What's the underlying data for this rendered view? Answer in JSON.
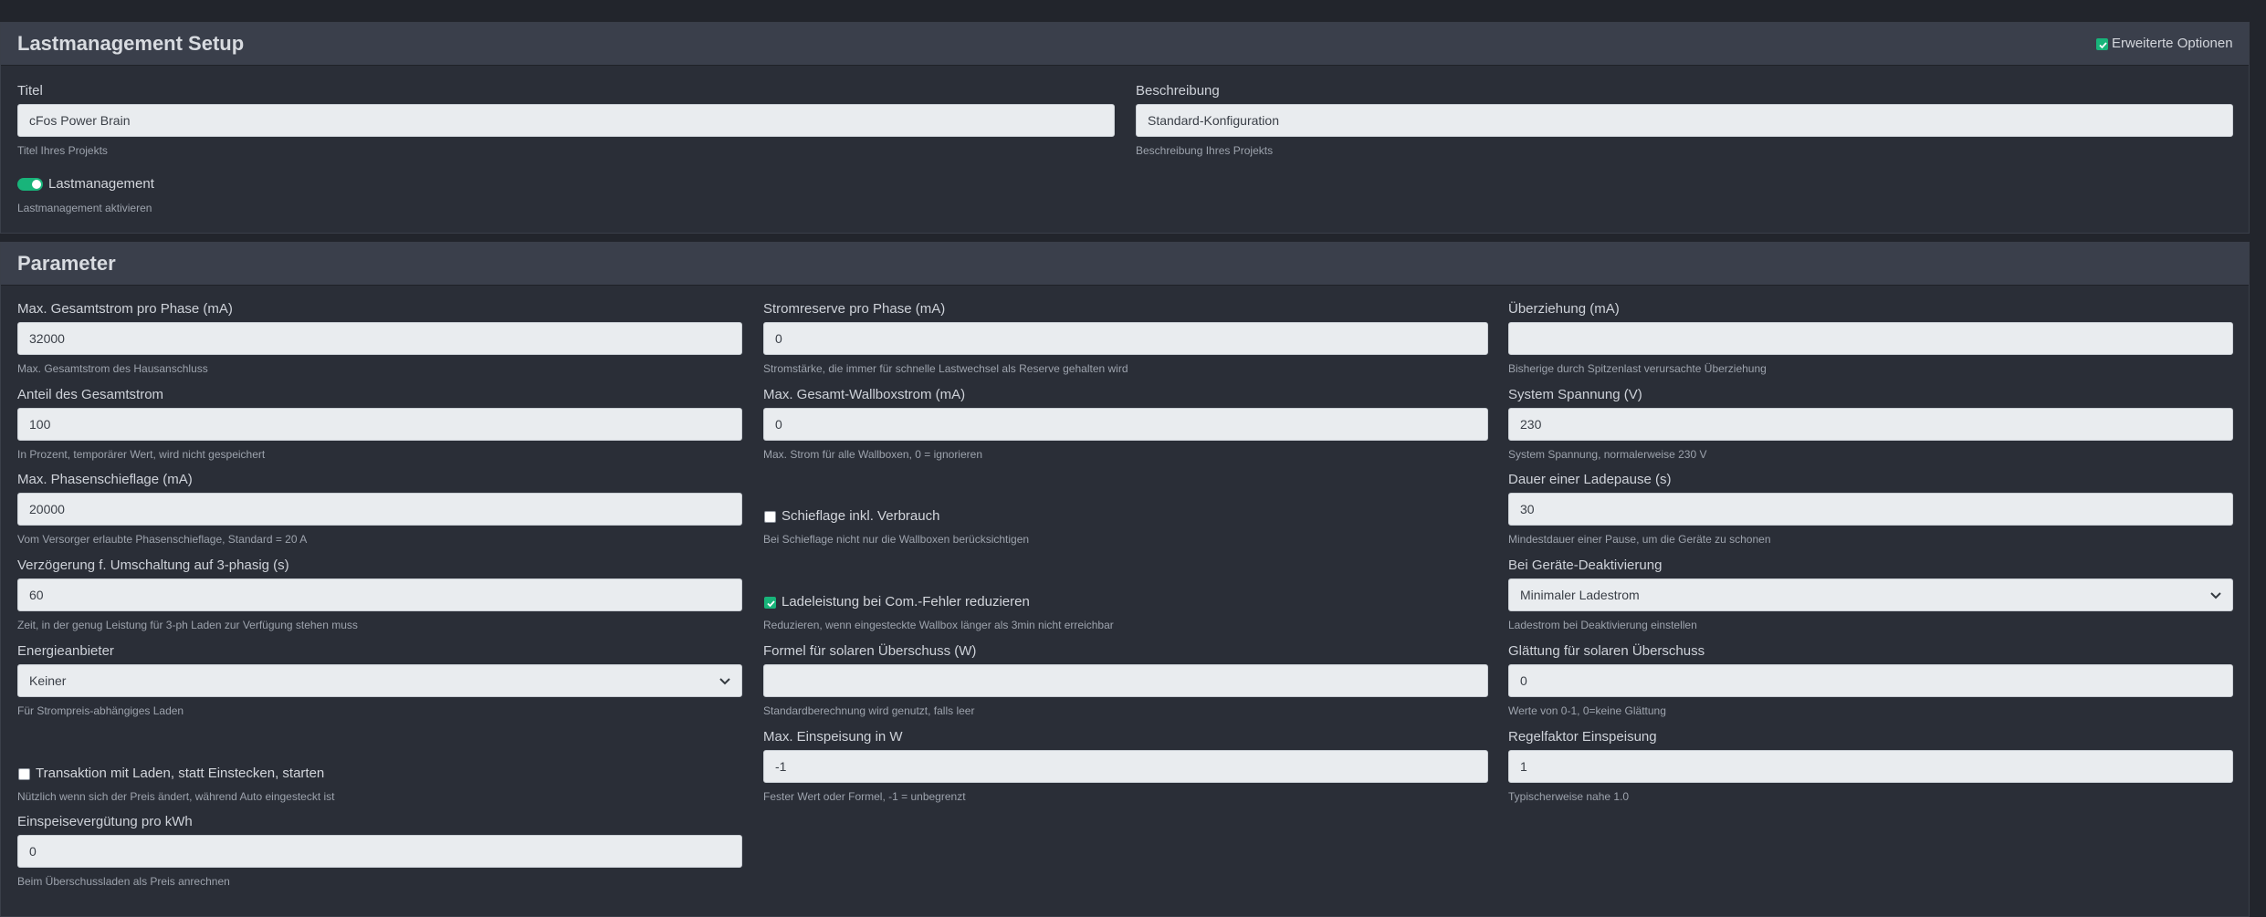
{
  "setup": {
    "title": "Lastmanagement Setup",
    "advanced_label": "Erweiterte Optionen",
    "advanced_checked": true,
    "titel": {
      "label": "Titel",
      "value": "cFos Power Brain",
      "help": "Titel Ihres Projekts"
    },
    "beschreibung": {
      "label": "Beschreibung",
      "value": "Standard-Konfiguration",
      "help": "Beschreibung Ihres Projekts"
    },
    "lastmanagement": {
      "label": "Lastmanagement",
      "on": true,
      "help": "Lastmanagement aktivieren"
    }
  },
  "params": {
    "title": "Parameter",
    "max_gesamtstrom": {
      "label": "Max. Gesamtstrom pro Phase (mA)",
      "value": "32000",
      "help": "Max. Gesamtstrom des Hausanschluss"
    },
    "stromreserve": {
      "label": "Stromreserve pro Phase (mA)",
      "value": "0",
      "help": "Stromstärke, die immer für schnelle Lastwechsel als Reserve gehalten wird"
    },
    "ueberziehung": {
      "label": "Überziehung (mA)",
      "value": "",
      "help": "Bisherige durch Spitzenlast verursachte Überziehung"
    },
    "anteil": {
      "label": "Anteil des Gesamtstrom",
      "value": "100",
      "help": "In Prozent, temporärer Wert, wird nicht gespeichert"
    },
    "max_wallbox": {
      "label": "Max. Gesamt-Wallboxstrom (mA)",
      "value": "0",
      "help": "Max. Strom für alle Wallboxen, 0 = ignorieren"
    },
    "spannung": {
      "label": "System Spannung (V)",
      "value": "230",
      "help": "System Spannung, normalerweise 230 V"
    },
    "schieflage": {
      "label": "Max. Phasenschieflage (mA)",
      "value": "20000",
      "help": "Vom Versorger erlaubte Phasenschieflage, Standard = 20 A"
    },
    "schieflage_verbrauch": {
      "label": "Schieflage inkl. Verbrauch",
      "checked": false,
      "help": "Bei Schieflage nicht nur die Wallboxen berücksichtigen"
    },
    "ladepause": {
      "label": "Dauer einer Ladepause (s)",
      "value": "30",
      "help": "Mindestdauer einer Pause, um die Geräte zu schonen"
    },
    "verzoegerung": {
      "label": "Verzögerung f. Umschaltung auf 3-phasig (s)",
      "value": "60",
      "help": "Zeit, in der genug Leistung für 3-ph Laden zur Verfügung stehen muss"
    },
    "com_fehler": {
      "label": "Ladeleistung bei Com.-Fehler reduzieren",
      "checked": true,
      "help": "Reduzieren, wenn eingesteckte Wallbox länger als 3min nicht erreichbar"
    },
    "deaktivierung": {
      "label": "Bei Geräte-Deaktivierung",
      "value": "Minimaler Ladestrom",
      "help": "Ladestrom bei Deaktivierung einstellen"
    },
    "energieanbieter": {
      "label": "Energieanbieter",
      "value": "Keiner",
      "help": "Für Strompreis-abhängiges Laden"
    },
    "formel": {
      "label": "Formel für solaren Überschuss (W)",
      "value": "",
      "help": "Standardberechnung wird genutzt, falls leer"
    },
    "glaettung": {
      "label": "Glättung für solaren Überschuss",
      "value": "0",
      "help": "Werte von 0-1, 0=keine Glättung"
    },
    "transaktion": {
      "label": "Transaktion mit Laden, statt Einstecken, starten",
      "checked": false,
      "help": "Nützlich wenn sich der Preis ändert, während Auto eingesteckt ist"
    },
    "einspeisung": {
      "label": "Max. Einspeisung in W",
      "value": "-1",
      "help": "Fester Wert oder Formel, -1 = unbegrenzt"
    },
    "regelfaktor": {
      "label": "Regelfaktor Einspeisung",
      "value": "1",
      "help": "Typischerweise nahe 1.0"
    },
    "verguetung": {
      "label": "Einspeisevergütung pro kWh",
      "value": "0",
      "help": "Beim Überschussladen als Preis anrechnen"
    }
  }
}
